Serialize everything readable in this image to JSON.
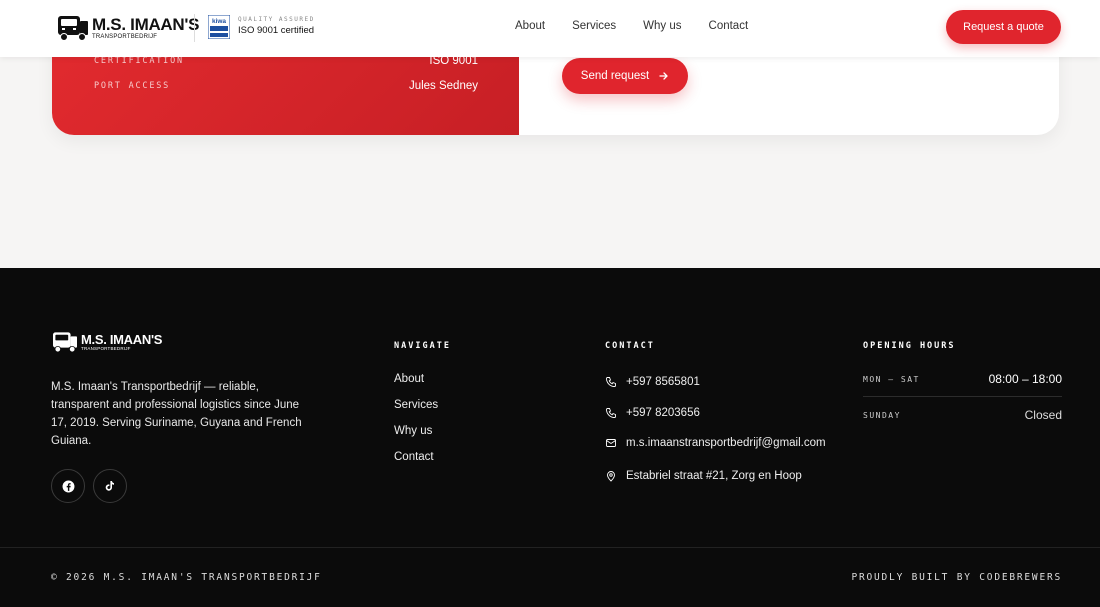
{
  "brand": {
    "name": "M.S. IMAAN'S",
    "sub": "TRANSPORTBEDRIJF",
    "kiwa_label": "kiwa",
    "quality_tag": "QUALITY ASSURED",
    "certification": "ISO 9001 certified"
  },
  "nav": {
    "items": [
      {
        "label": "About"
      },
      {
        "label": "Services"
      },
      {
        "label": "Why us"
      },
      {
        "label": "Contact"
      }
    ],
    "cta": "Request a quote"
  },
  "card": {
    "rows": [
      {
        "label": "CERTIFICATION",
        "value": "ISO 9001"
      },
      {
        "label": "PORT ACCESS",
        "value": "Jules Sedney"
      }
    ],
    "send_label": "Send request"
  },
  "footer": {
    "description": "M.S. Imaan's Transportbedrijf — reliable, transparent and professional logistics since June 17, 2019. Serving Suriname, Guyana and French Guiana.",
    "social": [
      "facebook-icon",
      "tiktok-icon"
    ],
    "navigate": {
      "title": "NAVIGATE",
      "links": [
        "About",
        "Services",
        "Why us",
        "Contact"
      ]
    },
    "contact": {
      "title": "CONTACT",
      "phone1": "+597 8565801",
      "phone2": "+597 8203656",
      "email": "m.s.imaanstransportbedrijf@gmail.com",
      "address": "Estabriel straat #21, Zorg en Hoop"
    },
    "hours": {
      "title": "OPENING HOURS",
      "rows": [
        {
          "day": "MON – SAT",
          "time": "08:00 – 18:00"
        },
        {
          "day": "SUNDAY",
          "time": "Closed"
        }
      ]
    },
    "copyright": "© 2026 M.S. IMAAN'S TRANSPORTBEDRIJF",
    "built": "PROUDLY BUILT BY CODEBREWERS"
  },
  "colors": {
    "accent": "#e0252d",
    "footer_bg": "#0b0b0b",
    "page_bg": "#f6f5f4"
  }
}
